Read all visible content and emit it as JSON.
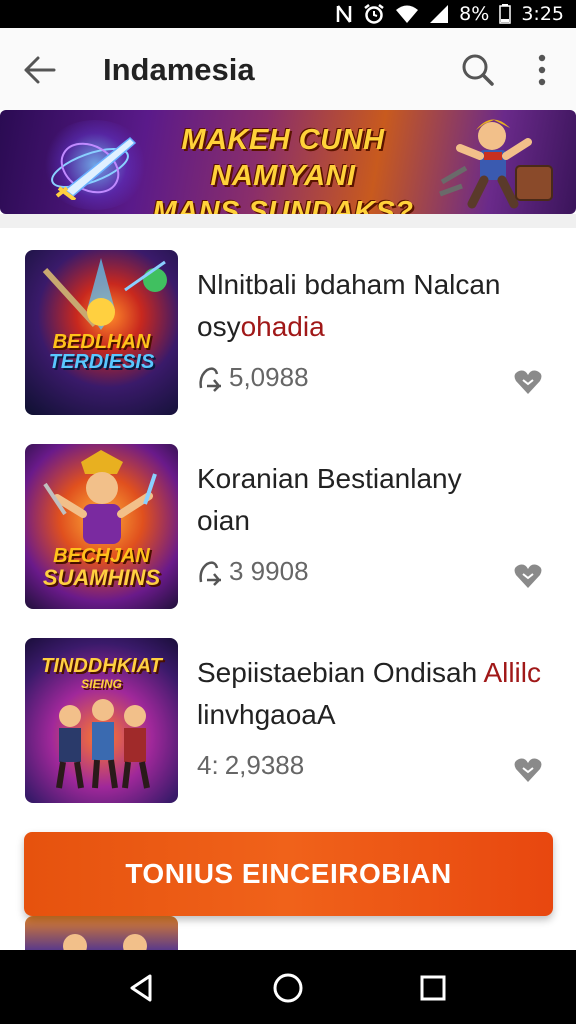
{
  "status_bar": {
    "battery_text": "8%",
    "time": "3:25"
  },
  "app_bar": {
    "title": "Indamesia"
  },
  "banner": {
    "line1": "MAKEH CUNH NAMIYANI",
    "line2": "MANS SUNDAKS?"
  },
  "items": [
    {
      "thumb_label_1": "BEDLHAN",
      "thumb_label_2": "TERDIESIS",
      "name_line1": "Nlnitbali bdaham Nalcan",
      "name_line2_a": "osy",
      "name_line2_b": "ohadia",
      "stat_prefix": "",
      "stat_value": "5,0988",
      "stat_icon": "download-icon"
    },
    {
      "thumb_label_1": "BECHJAN",
      "thumb_label_2": "SUAMHINS",
      "name_line1": "Koranian Bestianlany",
      "name_line2_a": "oian",
      "name_line2_b": "",
      "stat_prefix": "",
      "stat_value": "3 9908",
      "stat_icon": "download-icon"
    },
    {
      "thumb_label_1": "TINDDHKIAT",
      "thumb_label_2": "SIEING",
      "name_line1_a": "Sepiistaebian Ondisah ",
      "name_line1_b": "Allilc",
      "name_line2_a": "linvhgaoaA",
      "name_line2_b": "",
      "stat_prefix": "4:",
      "stat_value": "2,9388",
      "stat_icon": ""
    }
  ],
  "cta": {
    "label": "TONIUS EINCEIROBIAN"
  },
  "colors": {
    "accent": "#e6520e",
    "link_red": "#a01818"
  }
}
